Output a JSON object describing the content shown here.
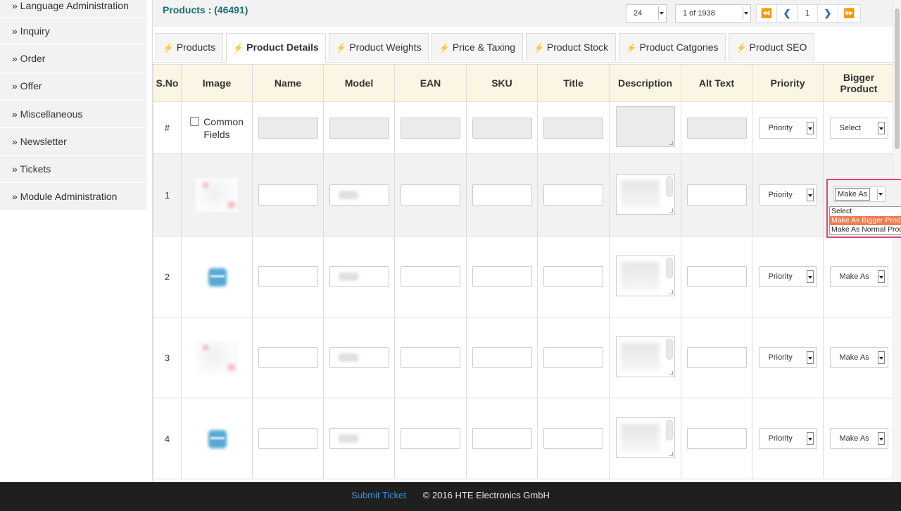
{
  "sidebar": {
    "items": [
      {
        "label": "» Language Administration"
      },
      {
        "label": "» Inquiry"
      },
      {
        "label": "» Order"
      },
      {
        "label": "» Offer"
      },
      {
        "label": "» Miscellaneous"
      },
      {
        "label": "» Newsletter"
      },
      {
        "label": "» Tickets"
      },
      {
        "label": "» Module Administration"
      }
    ]
  },
  "header": {
    "products_count": "Products : (46491)",
    "per_page": "24",
    "page_select": "1 of 1938",
    "pager": {
      "first": "⏪",
      "prev": "❮",
      "current": "1",
      "next": "❯",
      "last": "⏩"
    }
  },
  "tabs": [
    {
      "label": "Products"
    },
    {
      "label": "Product Details",
      "active": true
    },
    {
      "label": "Product Weights"
    },
    {
      "label": "Price & Taxing"
    },
    {
      "label": "Product Stock"
    },
    {
      "label": "Product Catgories"
    },
    {
      "label": "Product SEO"
    }
  ],
  "table": {
    "columns": [
      "S.No",
      "Image",
      "Name",
      "Model",
      "EAN",
      "SKU",
      "Title",
      "Description",
      "Alt Text",
      "Priority",
      "Bigger Product"
    ],
    "common_row": {
      "sno": "#",
      "common_fields_label": "Common Fields",
      "priority": "Priority",
      "bigger": "Select"
    },
    "rows": [
      {
        "sno": "1",
        "priority": "Priority",
        "bigger": "Make As"
      },
      {
        "sno": "2",
        "priority": "Priority",
        "bigger": "Make As"
      },
      {
        "sno": "3",
        "priority": "Priority",
        "bigger": "Make As"
      },
      {
        "sno": "4",
        "priority": "Priority",
        "bigger": "Make As"
      }
    ]
  },
  "dropdown": {
    "current": "Make As",
    "options": [
      "Select",
      "Make As Bigger Product",
      "Make As Normal Product"
    ],
    "highlighted": "Make As Bigger Product"
  },
  "footer": {
    "link": "Submit Ticket",
    "copyright": "© 2016 HTE Electronics GmbH"
  },
  "colors": {
    "header_bg": "#fbf5e3",
    "accent_teal": "#1f6e6e",
    "link_blue": "#2a6fb0",
    "highlight": "#f07b4f",
    "focus_border": "#e0457b",
    "footer_bg": "#1f1f1f"
  }
}
